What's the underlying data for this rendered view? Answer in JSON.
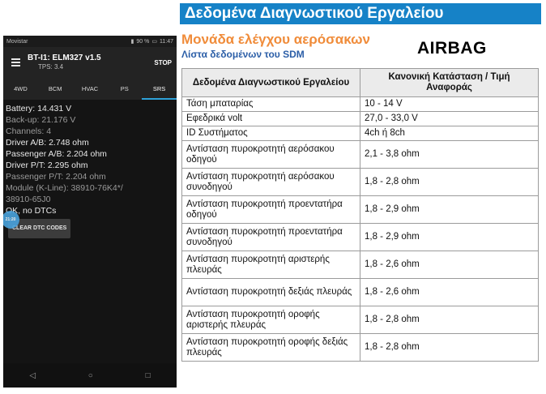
{
  "phone": {
    "status": {
      "carrier": "Movistar",
      "battery": "90 %",
      "time": "11:47"
    },
    "app": {
      "title": "BT-I1: ELM327 v1.5",
      "tps": "TPS: 3.4",
      "stop_label": "STOP"
    },
    "tabs": [
      "4WD",
      "BCM",
      "HVAC",
      "PS",
      "SRS"
    ],
    "active_tab": "SRS",
    "readings": [
      {
        "text": "Battery: 14.431 V",
        "dim": false
      },
      {
        "text": "Back-up: 21.176 V",
        "dim": true
      },
      {
        "text": "Channels: 4",
        "dim": true
      },
      {
        "text": "Driver A/B: 2.748 ohm",
        "dim": false
      },
      {
        "text": "Passenger A/B: 2.204 ohm",
        "dim": false
      },
      {
        "text": "Driver P/T: 2.295 ohm",
        "dim": false
      },
      {
        "text": "Passenger P/T: 2.204 ohm",
        "dim": true
      },
      {
        "text": "Module (K-Line): 38910-76K4*/",
        "dim": true
      },
      {
        "text": "38910-65J0",
        "dim": true
      },
      {
        "text": "OK, no DTCs",
        "dim": false
      }
    ],
    "ripple_label": "21:20",
    "clear_button": "CLEAR DTC CODES",
    "nav": {
      "back": "◁",
      "home": "○",
      "recent": "□"
    }
  },
  "doc": {
    "header": "Δεδομένα Διαγνωστικού Εργαλείου",
    "subtitle": "Μονάδα ελέγχου αερόσακων",
    "subsubtitle": "Λίστα δεδομένων του SDM",
    "badge": "AIRBAG",
    "table": {
      "headers": [
        "Δεδομένα Διαγνωστικού Εργαλείου",
        "Κανονική Κατάσταση / Τιμή Αναφοράς"
      ],
      "rows": [
        [
          "Τάση μπαταρίας",
          "10 - 14 V"
        ],
        [
          "Εφεδρικά volt",
          "27,0 - 33,0 V"
        ],
        [
          "ID Συστήματος",
          "4ch ή 8ch"
        ],
        [
          "Αντίσταση πυροκροτητή αερόσακου οδηγού",
          "2,1 - 3,8 ohm"
        ],
        [
          "Αντίσταση πυροκροτητή αερόσακου συνοδηγού",
          "1,8 - 2,8 ohm"
        ],
        [
          "Αντίσταση πυροκροτητή προεντατήρα οδηγού",
          "1,8 - 2,9 ohm"
        ],
        [
          "Αντίσταση πυροκροτητή προεντατήρα συνοδηγού",
          "1,8 - 2,9 ohm"
        ],
        [
          "Αντίσταση πυροκροτητή αριστερής πλευράς",
          "1,8 - 2,6 ohm"
        ],
        [
          "Αντίσταση πυροκροτητή δεξιάς πλευράς",
          "1,8 - 2,6 ohm"
        ],
        [
          "Αντίσταση πυροκροτητή οροφής αριστερής πλευράς",
          "1,8 - 2,8 ohm"
        ],
        [
          "Αντίσταση πυροκροτητή οροφής δεξιάς πλευράς",
          "1,8 - 2,8 ohm"
        ]
      ]
    }
  }
}
